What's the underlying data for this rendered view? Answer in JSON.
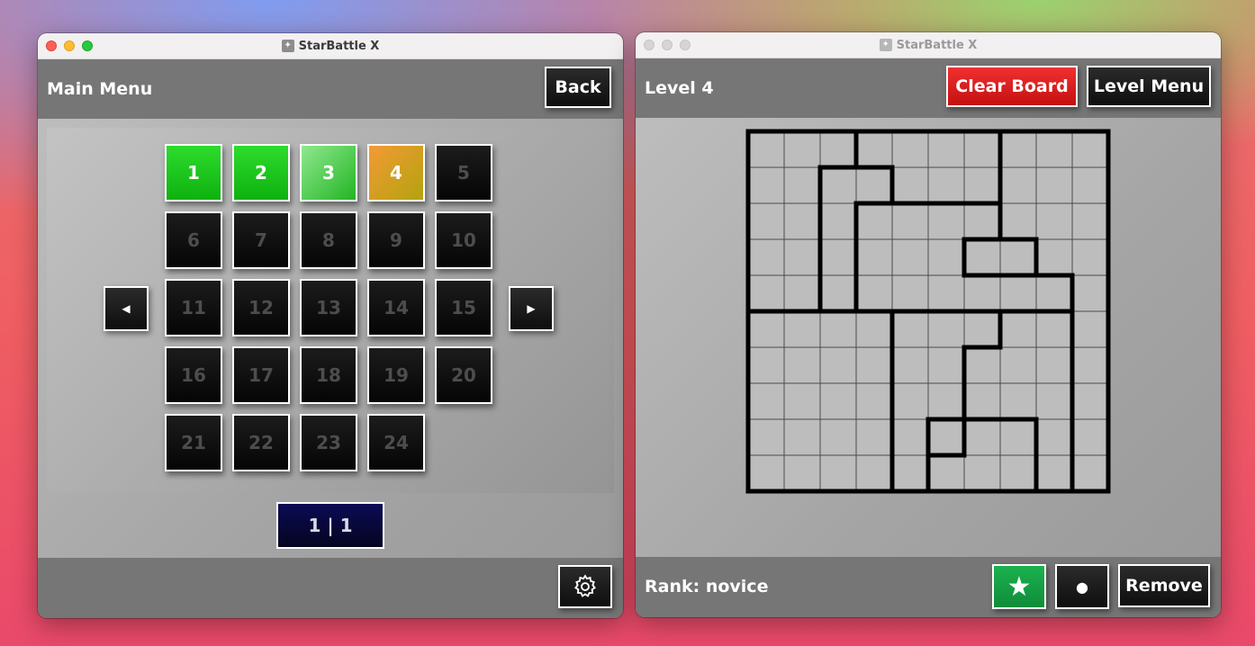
{
  "left_window": {
    "title": "StarBattle X",
    "app_icon": "runner-icon",
    "header": {
      "title": "Main Menu",
      "back_label": "Back"
    },
    "levels": [
      {
        "label": "1",
        "state": "completed"
      },
      {
        "label": "2",
        "state": "completed"
      },
      {
        "label": "3",
        "state": "current"
      },
      {
        "label": "4",
        "state": "in-progress"
      },
      {
        "label": "5",
        "state": "locked"
      },
      {
        "label": "6",
        "state": "locked"
      },
      {
        "label": "7",
        "state": "locked"
      },
      {
        "label": "8",
        "state": "locked"
      },
      {
        "label": "9",
        "state": "locked"
      },
      {
        "label": "10",
        "state": "locked"
      },
      {
        "label": "11",
        "state": "locked"
      },
      {
        "label": "12",
        "state": "locked"
      },
      {
        "label": "13",
        "state": "locked"
      },
      {
        "label": "14",
        "state": "locked"
      },
      {
        "label": "15",
        "state": "locked"
      },
      {
        "label": "16",
        "state": "locked"
      },
      {
        "label": "17",
        "state": "locked"
      },
      {
        "label": "18",
        "state": "locked"
      },
      {
        "label": "19",
        "state": "locked"
      },
      {
        "label": "20",
        "state": "locked"
      },
      {
        "label": "21",
        "state": "locked"
      },
      {
        "label": "22",
        "state": "locked"
      },
      {
        "label": "23",
        "state": "locked"
      },
      {
        "label": "24",
        "state": "locked"
      }
    ],
    "prev_icon": "◀",
    "next_icon": "▶",
    "page_indicator": "1 | 1",
    "settings_icon": "gear-icon"
  },
  "right_window": {
    "title": "StarBattle X",
    "app_icon": "runner-icon",
    "header": {
      "title": "Level 4",
      "clear_label": "Clear Board",
      "level_menu_label": "Level Menu"
    },
    "board": {
      "size": 10,
      "regions": [
        [
          0,
          0,
          0,
          1,
          1,
          1,
          1,
          2,
          2,
          2
        ],
        [
          0,
          0,
          3,
          3,
          1,
          1,
          1,
          2,
          2,
          2
        ],
        [
          0,
          0,
          3,
          4,
          4,
          4,
          4,
          2,
          2,
          2
        ],
        [
          0,
          0,
          3,
          4,
          4,
          4,
          5,
          5,
          2,
          2
        ],
        [
          0,
          0,
          3,
          4,
          4,
          4,
          4,
          4,
          4,
          2
        ],
        [
          6,
          6,
          6,
          6,
          7,
          7,
          7,
          8,
          8,
          2
        ],
        [
          6,
          6,
          6,
          6,
          7,
          7,
          8,
          8,
          8,
          2
        ],
        [
          6,
          6,
          6,
          6,
          7,
          7,
          8,
          8,
          8,
          2
        ],
        [
          6,
          6,
          6,
          6,
          7,
          8,
          9,
          9,
          8,
          2
        ],
        [
          6,
          6,
          6,
          6,
          7,
          9,
          9,
          9,
          8,
          2
        ]
      ],
      "colors": {
        "cell": "#bdbdbd",
        "grid": "#4a4a4a",
        "border": "#000000"
      }
    },
    "footer": {
      "rank": "Rank: novice",
      "star_icon": "★",
      "dot_icon": "●",
      "remove_label": "Remove"
    }
  },
  "colors": {
    "accent_green": "#15a84a",
    "clear_red": "#e02020",
    "page_navy": "#0a0a40"
  }
}
